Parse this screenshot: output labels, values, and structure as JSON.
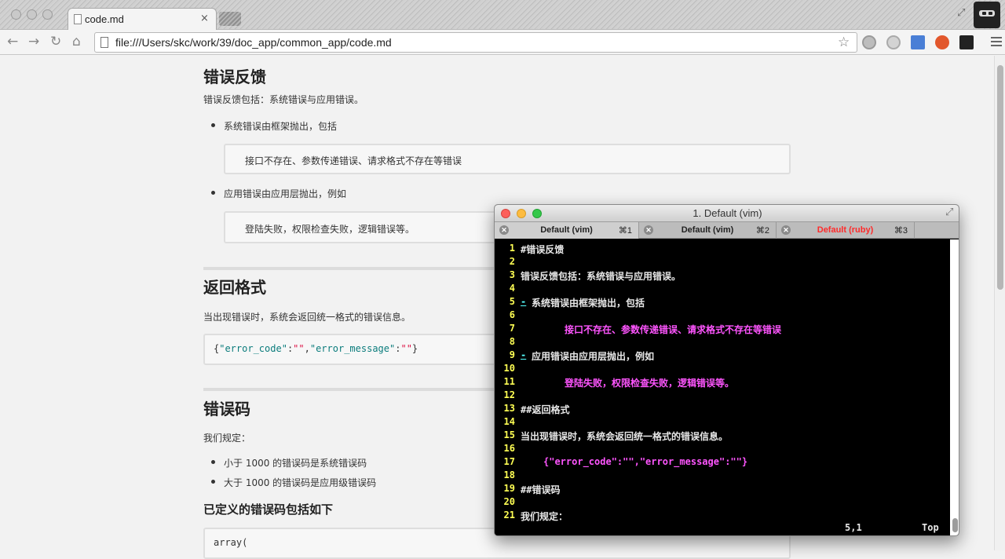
{
  "browser": {
    "tab_title": "code.md",
    "tab_close": "×",
    "url": "file:///Users/skc/work/39/doc_app/common_app/code.md"
  },
  "doc": {
    "h1": "错误反馈",
    "intro": "错误反馈包括：系统错误与应用错误。",
    "bullet1": "系统错误由框架抛出，包括",
    "code1": "接口不存在、参数传递错误、请求格式不存在等错误",
    "bullet2": "应用错误由应用层抛出，例如",
    "code2": "登陆失败，权限检查失败，逻辑错误等。",
    "h2": "返回格式",
    "format_text": "当出现错误时，系统会返回统一格式的错误信息。",
    "json_code": {
      "open": "{",
      "k1": "\"error_code\"",
      "c1": ":",
      "v1": "\"\"",
      "comma": ",",
      "k2": "\"error_message\"",
      "c2": ":",
      "v2": "\"\"",
      "close": "}"
    },
    "h3": "错误码",
    "rules": "我们规定：",
    "rule1": "小于 1000 的错误码是系统错误码",
    "rule2": "大于 1000 的错误码是应用级错误码",
    "h4": "已定义的错误码包括如下",
    "array_code": "array("
  },
  "terminal": {
    "window_title": "1. Default (vim)",
    "tabs": [
      {
        "label": "Default (vim)",
        "shortcut": "⌘1"
      },
      {
        "label": "Default (vim)",
        "shortcut": "⌘2"
      },
      {
        "label": "Default (ruby)",
        "shortcut": "⌘3"
      }
    ],
    "lines": [
      {
        "n": "1",
        "text": "#错误反馈"
      },
      {
        "n": "2",
        "text": ""
      },
      {
        "n": "3",
        "text": "错误反馈包括：系统错误与应用错误。"
      },
      {
        "n": "4",
        "text": ""
      },
      {
        "n": "5",
        "marker": "-",
        "text": "系统错误由框架抛出，包括"
      },
      {
        "n": "6",
        "text": ""
      },
      {
        "n": "7",
        "text": "接口不存在、参数传递错误、请求格式不存在等错误"
      },
      {
        "n": "8",
        "text": ""
      },
      {
        "n": "9",
        "marker": "-",
        "text": "应用错误由应用层抛出，例如"
      },
      {
        "n": "10",
        "text": ""
      },
      {
        "n": "11",
        "text": "登陆失败，权限检查失败，逻辑错误等。"
      },
      {
        "n": "12",
        "text": ""
      },
      {
        "n": "13",
        "text": "##返回格式"
      },
      {
        "n": "14",
        "text": ""
      },
      {
        "n": "15",
        "text": "当出现错误时，系统会返回统一格式的错误信息。"
      },
      {
        "n": "16",
        "text": ""
      },
      {
        "n": "17",
        "text": "{\"error_code\":\"\",\"error_message\":\"\"}"
      },
      {
        "n": "18",
        "text": ""
      },
      {
        "n": "19",
        "text": "##错误码"
      },
      {
        "n": "20",
        "text": ""
      },
      {
        "n": "21",
        "text": "我们规定："
      }
    ],
    "cursor_pos": "5,1",
    "scroll_pos": "Top",
    "colors": {
      "line_number": "#ffff54",
      "code": "#ff55ff",
      "marker": "#55ffff",
      "active_tab_text": "#ff2a2a"
    }
  }
}
